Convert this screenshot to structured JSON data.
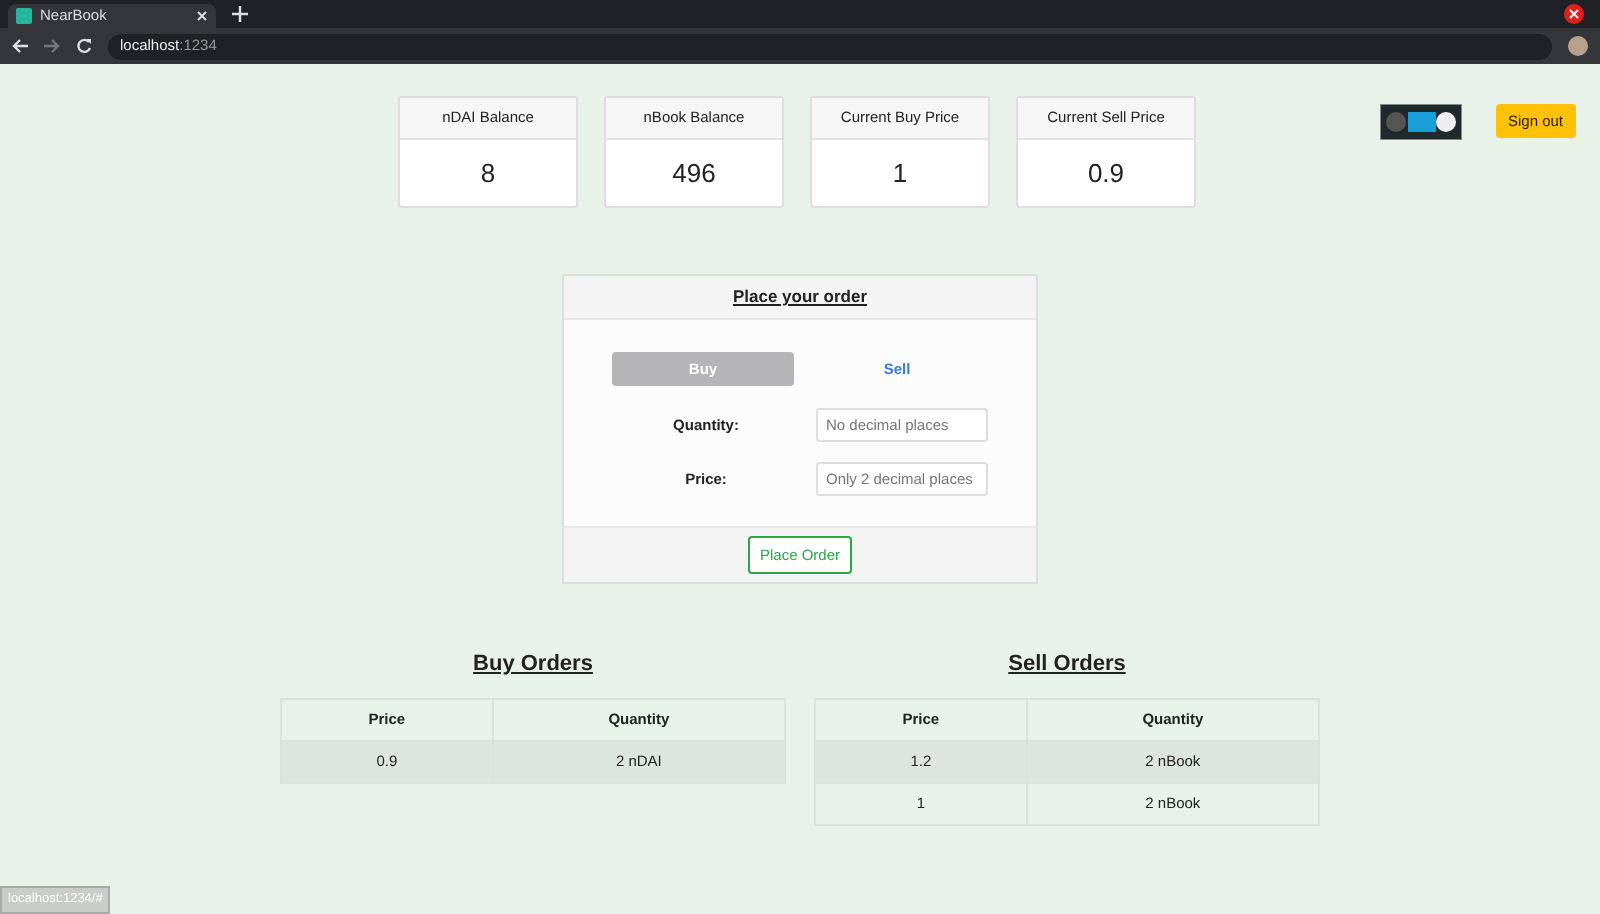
{
  "browser": {
    "tab_title": "NearBook",
    "url_host": "localhost",
    "url_port": ":1234",
    "status_url": "localhost:1234/#"
  },
  "stats": [
    {
      "label": "nDAI Balance",
      "value": "8"
    },
    {
      "label": "nBook Balance",
      "value": "496"
    },
    {
      "label": "Current Buy Price",
      "value": "1"
    },
    {
      "label": "Current Sell Price",
      "value": "0.9"
    }
  ],
  "sign_out": "Sign out",
  "order_form": {
    "title": "Place your order",
    "sides": [
      {
        "label": "Buy",
        "selected": true
      },
      {
        "label": "Sell",
        "selected": false
      }
    ],
    "fields": [
      {
        "label": "Quantity:",
        "placeholder": "No decimal places",
        "kind": "number"
      },
      {
        "label": "Price:",
        "placeholder": "Only 2 decimal places",
        "kind": "text"
      }
    ],
    "submit": "Place Order"
  },
  "books": [
    {
      "title": "Buy Orders",
      "columns": [
        "Price",
        "Quantity"
      ],
      "rows": [
        [
          "0.9",
          "2 nDAI"
        ]
      ]
    },
    {
      "title": "Sell Orders",
      "columns": [
        "Price",
        "Quantity"
      ],
      "rows": [
        [
          "1.2",
          "2 nBook"
        ],
        [
          "1",
          "2 nBook"
        ]
      ]
    }
  ]
}
